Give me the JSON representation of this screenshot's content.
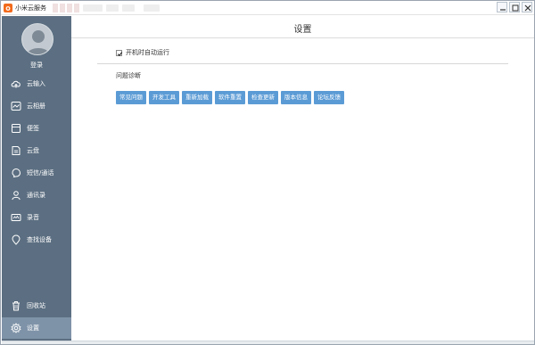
{
  "window": {
    "title": "小米云服务"
  },
  "sidebar": {
    "login_label": "登录",
    "items": [
      {
        "label": "云输入",
        "icon": "cloud-input-icon"
      },
      {
        "label": "云相册",
        "icon": "cloud-album-icon"
      },
      {
        "label": "便签",
        "icon": "notes-icon"
      },
      {
        "label": "云盘",
        "icon": "cloud-drive-icon"
      },
      {
        "label": "短信/通话",
        "icon": "sms-call-icon"
      },
      {
        "label": "通讯录",
        "icon": "contacts-icon"
      },
      {
        "label": "录音",
        "icon": "recording-icon"
      },
      {
        "label": "查找设备",
        "icon": "find-device-icon"
      },
      {
        "label": "回收站",
        "icon": "trash-icon"
      },
      {
        "label": "设置",
        "icon": "settings-icon"
      }
    ],
    "active": "设置"
  },
  "main": {
    "title": "设置",
    "autostart_label": "开机时自动运行",
    "autostart_checked": true,
    "diagnosis_title": "问题诊断",
    "buttons": [
      "常见问题",
      "开发工具",
      "重新加载",
      "软件重置",
      "检查更新",
      "版本信息",
      "论坛反馈"
    ]
  },
  "colors": {
    "sidebar_bg": "#5c6f82",
    "sidebar_active": "#7f93a8",
    "button_bg": "#5b9bd5",
    "app_icon": "#f26b1d"
  }
}
